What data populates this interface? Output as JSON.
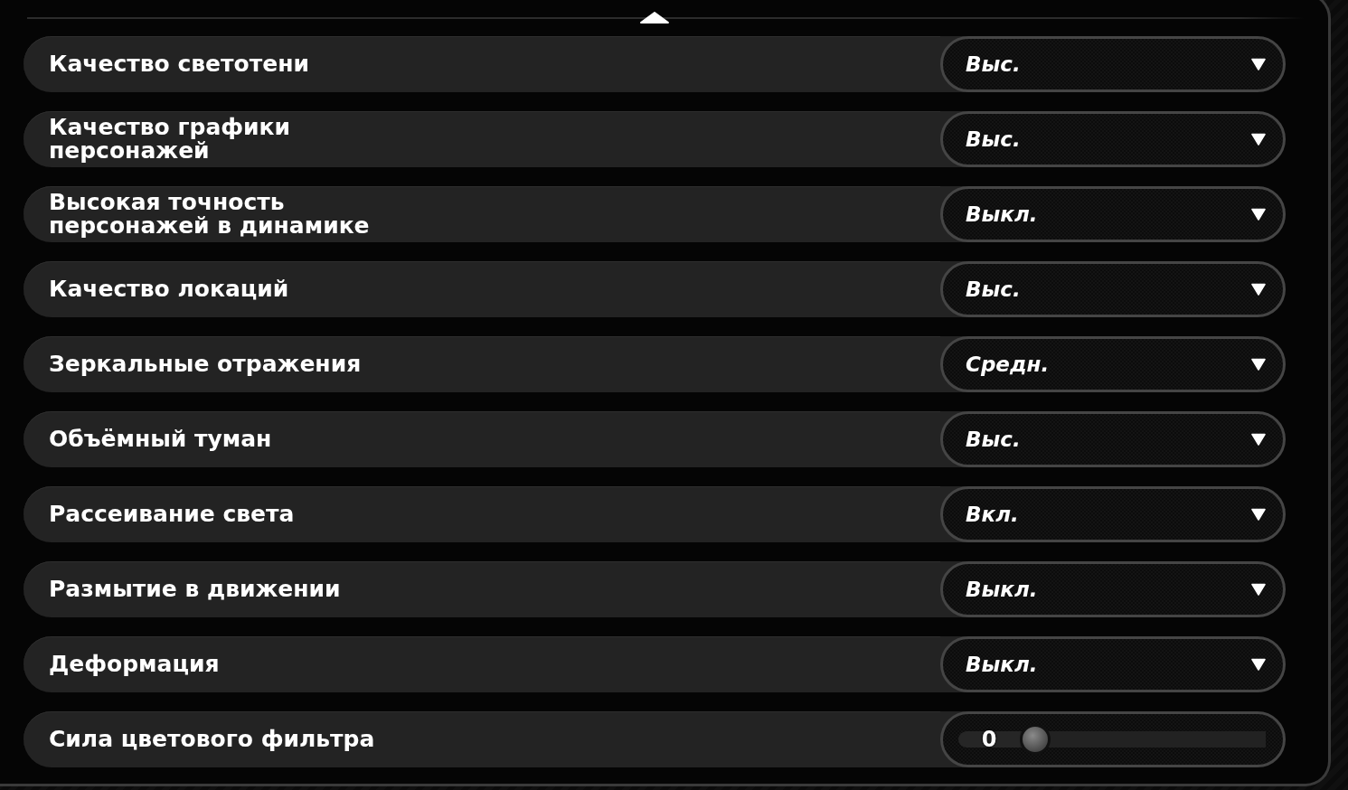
{
  "settings": [
    {
      "label": "Качество светотени",
      "kind": "dropdown",
      "value": "Выс."
    },
    {
      "label": "Качество графики\nперсонажей",
      "kind": "dropdown",
      "value": "Выс."
    },
    {
      "label": "Высокая точность\nперсонажей в динамике",
      "kind": "dropdown",
      "value": "Выкл."
    },
    {
      "label": "Качество локаций",
      "kind": "dropdown",
      "value": "Выс."
    },
    {
      "label": "Зеркальные отражения",
      "kind": "dropdown",
      "value": "Средн."
    },
    {
      "label": "Объёмный туман",
      "kind": "dropdown",
      "value": "Выс."
    },
    {
      "label": "Рассеивание света",
      "kind": "dropdown",
      "value": "Вкл."
    },
    {
      "label": "Размытие в движении",
      "kind": "dropdown",
      "value": "Выкл."
    },
    {
      "label": "Деформация",
      "kind": "dropdown",
      "value": "Выкл."
    },
    {
      "label": "Сила цветового фильтра",
      "kind": "slider",
      "value": "0",
      "level": 0
    }
  ]
}
